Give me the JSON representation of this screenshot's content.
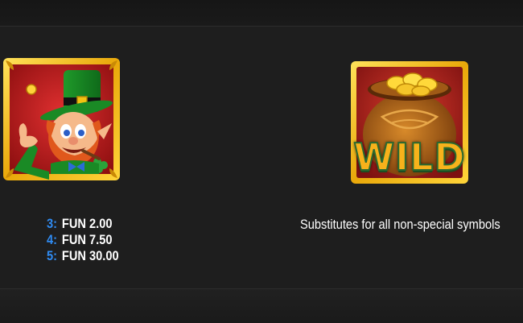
{
  "paytable": {
    "rows": [
      {
        "count": "3:",
        "value": "FUN 2.00"
      },
      {
        "count": "4:",
        "value": "FUN 7.50"
      },
      {
        "count": "5:",
        "value": "FUN 30.00"
      }
    ]
  },
  "wild": {
    "label": "WILD",
    "description": "Substitutes for all non-special symbols"
  },
  "colors": {
    "count_blue": "#2f8bf2",
    "frame_gold": "#f2c312",
    "wild_text": "#f7b21b"
  },
  "icons": [
    "leprechaun-symbol-icon",
    "pot-of-gold-wild-icon"
  ]
}
